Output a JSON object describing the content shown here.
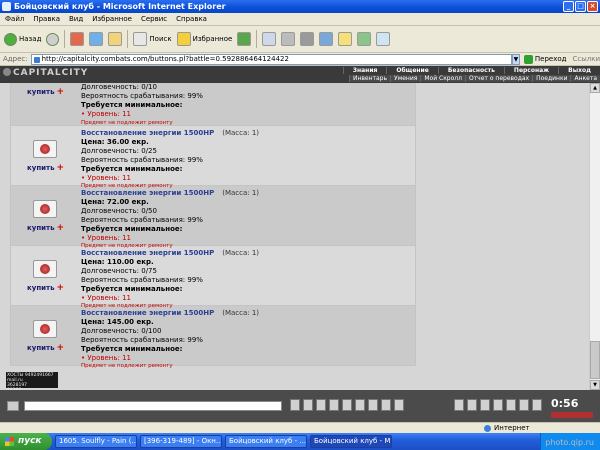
{
  "window": {
    "title": "Бойцовский клуб - Microsoft Internet Explorer"
  },
  "menu": [
    "Файл",
    "Правка",
    "Вид",
    "Избранное",
    "Сервис",
    "Справка"
  ],
  "toolbar": {
    "back": "Назад",
    "search": "Поиск",
    "favorites": "Избранное"
  },
  "address": {
    "label": "Адрес:",
    "url": "http://capitalcity.combats.com/buttons.pl?battle=0.592886464124422",
    "go": "Переход",
    "links": "Ссылки"
  },
  "game": {
    "logo": "CAPITALCITY",
    "nav_top": [
      "Знания",
      "Общение",
      "Безопасность",
      "Персонаж",
      "Выход"
    ],
    "nav_bottom": [
      "Инвентарь",
      "Умения",
      "Мой Скролл",
      "Отчет о переводах",
      "Поединки",
      "Анкета"
    ]
  },
  "shop": {
    "buy_label": "купить",
    "partial_top": {
      "durability": "Долговечность: 0/10",
      "chance": "Вероятность срабатывания: 99%",
      "req": "Требуется минимальное:",
      "level": "• Уровень: 11",
      "repair": "Предмет не подлежит ремонту"
    },
    "items": [
      {
        "name": "Восстановление энергии 1500HP",
        "mass": "(Масса: 1)",
        "price": "Цена: 36.00 екр.",
        "durability": "Долговечность: 0/25",
        "chance": "Вероятность срабатывания: 99%",
        "req": "Требуется минимальное:",
        "level": "• Уровень: 11",
        "repair": "Предмет не подлежит ремонту"
      },
      {
        "name": "Восстановление энергии 1500HP",
        "mass": "(Масса: 1)",
        "price": "Цена: 72.00 екр.",
        "durability": "Долговечность: 0/50",
        "chance": "Вероятность срабатывания: 99%",
        "req": "Требуется минимальное:",
        "level": "• Уровень: 11",
        "repair": "Предмет не подлежит ремонту"
      },
      {
        "name": "Восстановление энергии 1500HP",
        "mass": "(Масса: 1)",
        "price": "Цена: 110.00 екр.",
        "durability": "Долговечность: 0/75",
        "chance": "Вероятность срабатывания: 99%",
        "req": "Требуется минимальное:",
        "level": "• Уровень: 11",
        "repair": "Предмет не подлежит ремонту"
      },
      {
        "name": "Восстановление энергии 1500HP",
        "mass": "(Масса: 1)",
        "price": "Цена: 145.00 екр.",
        "durability": "Долговечность: 0/100",
        "chance": "Вероятность срабатывания: 99%",
        "req": "Требуется минимальное:",
        "level": "• Уровень: 11",
        "repair": "Предмет не подлежит ремонту"
      }
    ]
  },
  "counter": {
    "line1": "ХОСТЫ 9492491667",
    "line2": "mail.ru",
    "line3": "3628197",
    "line4": "11266"
  },
  "clock": "0:56",
  "status": {
    "zone": "Интернет"
  },
  "taskbar": {
    "start": "пуск",
    "tasks": [
      "1605. Soulfly - Pain (...",
      "[396-319-489] - Окн...",
      "Бойцовский клуб - ...",
      "Бойцовский клуб - М..."
    ]
  },
  "watermark": "photo.qip.ru"
}
